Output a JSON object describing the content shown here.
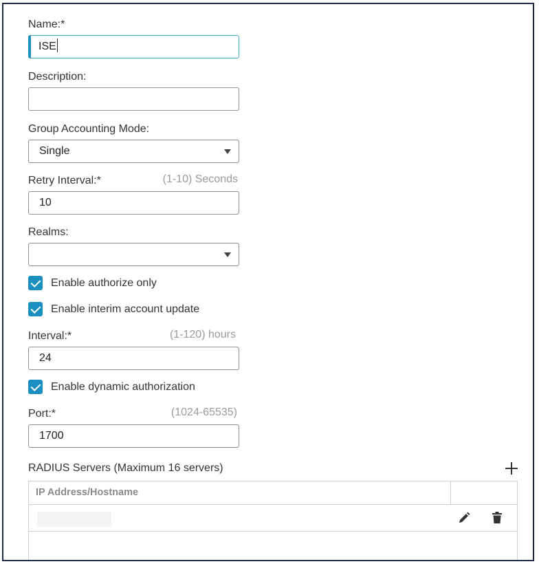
{
  "form": {
    "name": {
      "label": "Name:*",
      "value": "ISE"
    },
    "description": {
      "label": "Description:",
      "value": ""
    },
    "group_accounting_mode": {
      "label": "Group Accounting Mode:",
      "value": "Single"
    },
    "retry_interval": {
      "label": "Retry Interval:*",
      "hint": "(1-10) Seconds",
      "value": "10"
    },
    "realms": {
      "label": "Realms:",
      "value": ""
    },
    "enable_authorize_only": {
      "label": "Enable authorize only",
      "checked": true
    },
    "enable_interim_account_update": {
      "label": "Enable interim account update",
      "checked": true
    },
    "interval": {
      "label": "Interval:*",
      "hint": "(1-120) hours",
      "value": "24"
    },
    "enable_dynamic_authorization": {
      "label": "Enable dynamic authorization",
      "checked": true
    },
    "port": {
      "label": "Port:*",
      "hint": "(1024-65535)",
      "value": "1700"
    }
  },
  "radius_servers": {
    "title": "RADIUS Servers (Maximum 16 servers)",
    "columns": [
      "IP Address/Hostname"
    ],
    "rows": [
      {
        "host": ""
      }
    ]
  },
  "icons": {
    "add": "plus-icon",
    "edit": "pencil-icon",
    "delete": "trash-icon",
    "dropdown": "chevron-down-icon",
    "check": "check-icon"
  },
  "colors": {
    "accent": "#1b8fbf",
    "frame_border": "#1f2a44",
    "hint_text": "#9a9a9a"
  }
}
